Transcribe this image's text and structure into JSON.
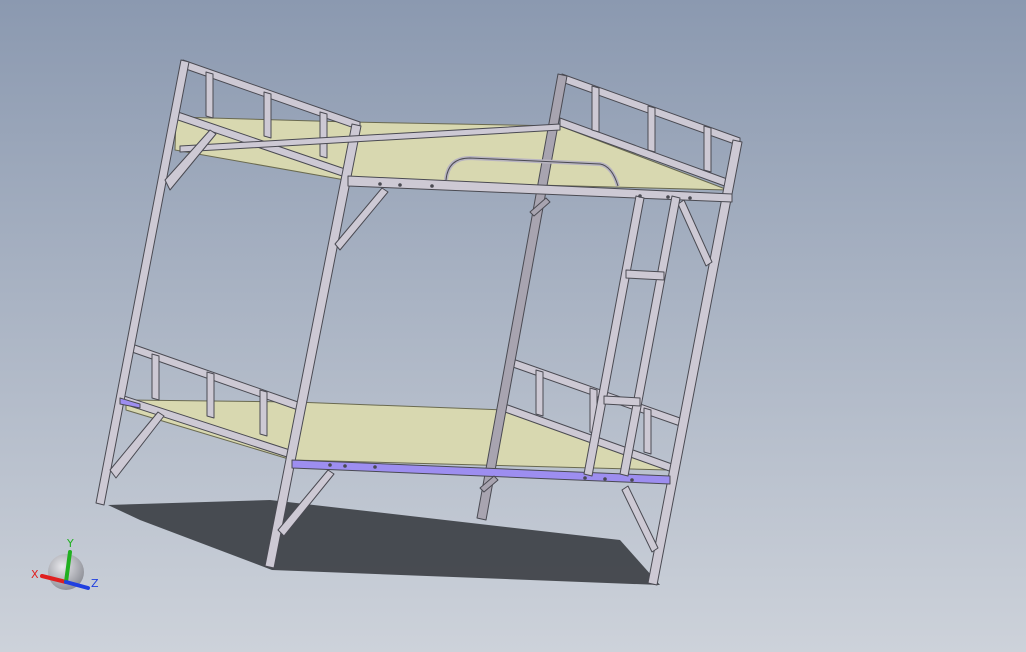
{
  "viewport": {
    "background_top": "#8b99b0",
    "background_bottom": "#cdd2da"
  },
  "model": {
    "frame_color": "#cdc9d4",
    "frame_shade": "#a8a4b0",
    "frame_edge": "#4a4a52",
    "deck_color": "#d8d8b0",
    "deck_edge": "#6a6a50",
    "rail_accent": "#9d8ef0",
    "shadow_color": "#3a3d42"
  },
  "triad": {
    "x_label": "X",
    "y_label": "Y",
    "z_label": "Z",
    "x_color": "#e02020",
    "y_color": "#20b020",
    "z_color": "#2040e0"
  }
}
